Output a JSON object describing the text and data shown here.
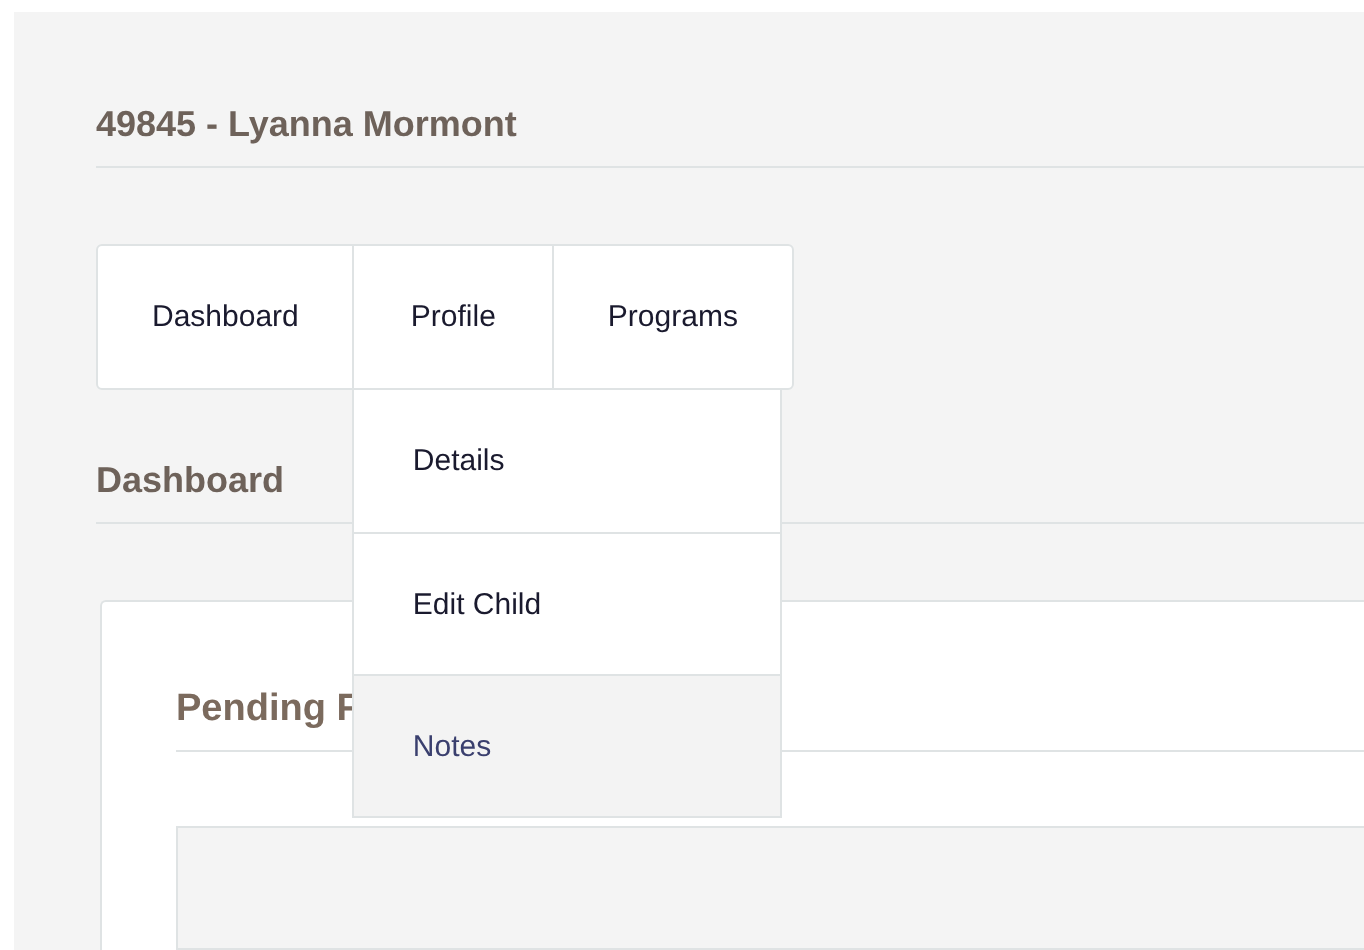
{
  "page_title": "49845 - Lyanna Mormont",
  "tabs": [
    {
      "label": "Dashboard"
    },
    {
      "label": "Profile",
      "menu": [
        {
          "label": "Details",
          "highlighted": false
        },
        {
          "label": "Edit Child",
          "highlighted": false
        },
        {
          "label": "Notes",
          "highlighted": true
        }
      ]
    },
    {
      "label": "Programs"
    }
  ],
  "section_title": "Dashboard",
  "card": {
    "title": "Pending F"
  }
}
